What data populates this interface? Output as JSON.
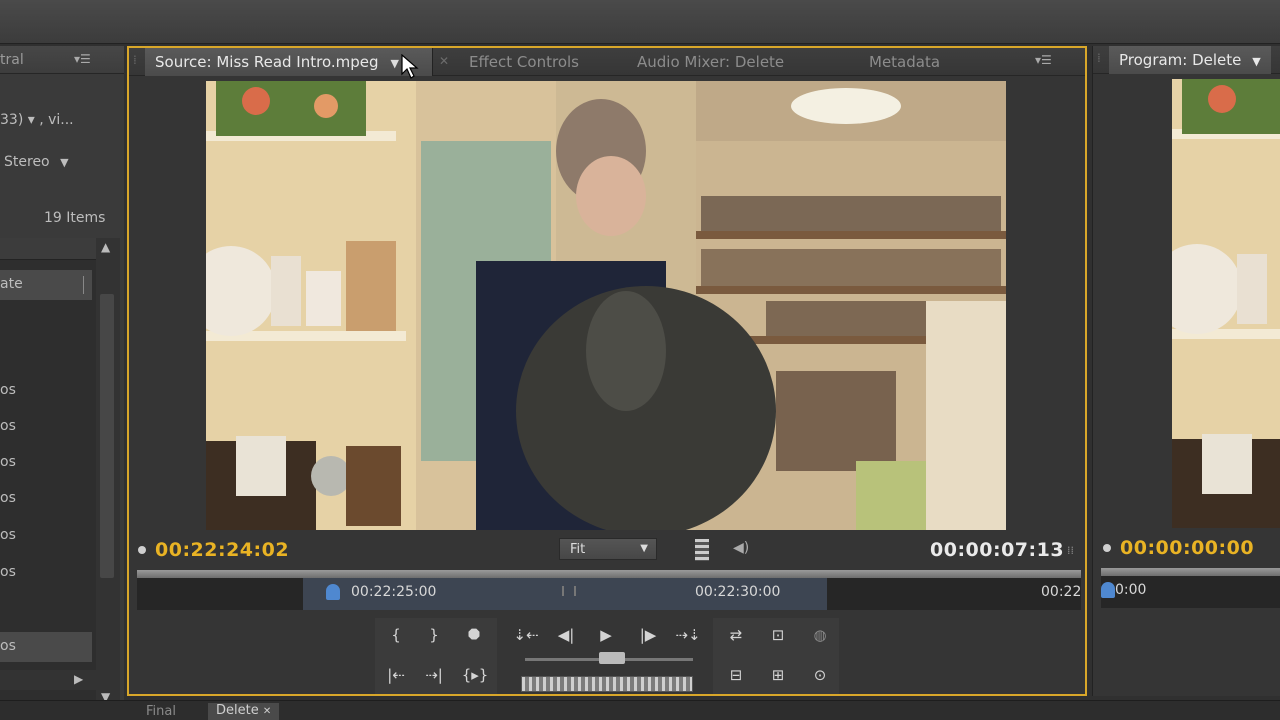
{
  "left_panel": {
    "tab_label": "tral",
    "info_line1": "33) ▾ , vi...",
    "audio_label": "Stereo",
    "item_count": "19 Items",
    "rows": [
      "ate",
      "os",
      "os",
      "os",
      "os",
      "os",
      "os",
      "os"
    ]
  },
  "source_monitor": {
    "tabs": [
      {
        "label": "Source: Miss Read Intro.mpeg",
        "active": true
      },
      {
        "label": "Effect Controls",
        "active": false
      },
      {
        "label": "Audio Mixer: Delete",
        "active": false
      },
      {
        "label": "Metadata",
        "active": false
      }
    ],
    "current_timecode": "00:22:24:02",
    "duration_timecode": "00:00:07:13",
    "zoom": "Fit",
    "ruler_labels": [
      "00:22:25:00",
      "00:22:30:00",
      "00:22"
    ],
    "playhead_fraction": 0.2,
    "controls_row1": [
      "{",
      "}",
      "⯃",
      "⇣⇠",
      "◀|",
      "▶",
      "|▶",
      "⇢⇣",
      "⇄",
      "⊡",
      "◍"
    ],
    "controls_row2": [
      "|⇠",
      "⇢|",
      "{▸}",
      "⊟",
      "⊞",
      "⊙"
    ]
  },
  "program_monitor": {
    "tab_label": "Program: Delete",
    "current_timecode": "00:00:00:00",
    "ruler_label": "0:00"
  },
  "bottom_tabs": [
    {
      "label": "Final",
      "active": false
    },
    {
      "label": "Delete",
      "active": true
    }
  ]
}
